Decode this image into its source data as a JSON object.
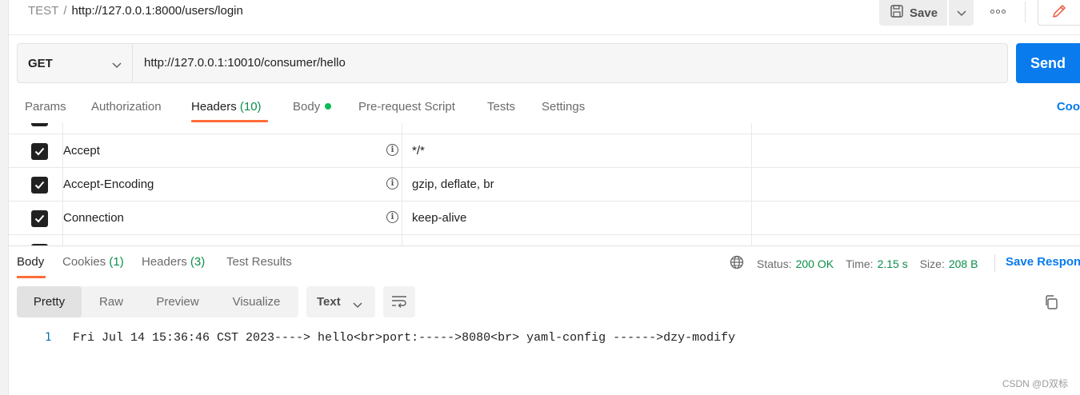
{
  "breadcrumb": {
    "collection": "TEST",
    "separator": "/",
    "request_name": "http://127.0.0.1:8000/users/login"
  },
  "toolbar": {
    "save_label": "Save"
  },
  "request": {
    "method": "GET",
    "url": "http://127.0.0.1:10010/consumer/hello",
    "send_label": "Send"
  },
  "request_tabs": [
    {
      "label": "Params"
    },
    {
      "label": "Authorization"
    },
    {
      "label": "Headers",
      "count": "(10)"
    },
    {
      "label": "Body"
    },
    {
      "label": "Pre-request Script"
    },
    {
      "label": "Tests"
    },
    {
      "label": "Settings"
    }
  ],
  "cookies_link": "Coo",
  "headers": [
    {
      "key": "Accept",
      "value": "*/*",
      "checked": true
    },
    {
      "key": "Accept-Encoding",
      "value": "gzip, deflate, br",
      "checked": true
    },
    {
      "key": "Connection",
      "value": "keep-alive",
      "checked": true
    }
  ],
  "response_tabs": [
    {
      "label": "Body"
    },
    {
      "label": "Cookies",
      "count": "(1)"
    },
    {
      "label": "Headers",
      "count": "(3)"
    },
    {
      "label": "Test Results"
    }
  ],
  "status": {
    "status_label": "Status:",
    "status_value": "200 OK",
    "time_label": "Time:",
    "time_value": "2.15 s",
    "size_label": "Size:",
    "size_value": "208 B"
  },
  "save_response": "Save Respon",
  "view_modes": [
    "Pretty",
    "Raw",
    "Preview",
    "Visualize"
  ],
  "format_select": "Text",
  "response_body": {
    "line_number": "1",
    "content": "Fri Jul 14 15:36:46 CST 2023----> hello<br>port:----->8080<br> yaml-config ------>dzy-modify"
  },
  "watermark": "CSDN @D双标",
  "colors": {
    "send_blue": "#097bed",
    "active_tab_orange": "#ff6c37",
    "status_green": "#0b8f4a",
    "body_dot_green": "#0cbb52"
  }
}
